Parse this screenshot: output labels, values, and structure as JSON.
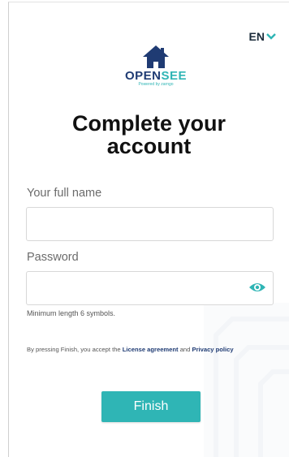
{
  "language": {
    "label": "EN"
  },
  "logo": {
    "part1": "OPEN",
    "part2": "SEE",
    "tagline": "Powered by zarngo"
  },
  "title": {
    "line1": "Complete your",
    "line2": "account"
  },
  "form": {
    "fullname_label": "Your full name",
    "fullname_value": "",
    "password_label": "Password",
    "password_value": "",
    "password_hint": "Minimum length 6 symbols."
  },
  "terms": {
    "prefix": "By pressing Finish, you accept the",
    "license_link": "License agreement",
    "and": "and",
    "privacy_link": "Privacy policy"
  },
  "actions": {
    "finish_label": "Finish"
  },
  "colors": {
    "accent": "#2fb5b5",
    "brand_dark": "#1f3b73"
  },
  "icons": {
    "language": "chevron-down-icon",
    "password_toggle": "eye-icon",
    "logo": "house-icon"
  }
}
